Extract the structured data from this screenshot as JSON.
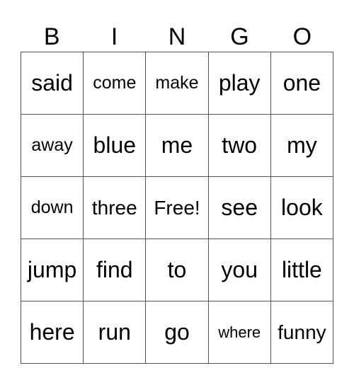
{
  "header": [
    "B",
    "I",
    "N",
    "G",
    "O"
  ],
  "rows": [
    [
      "said",
      "come",
      "make",
      "play",
      "one"
    ],
    [
      "away",
      "blue",
      "me",
      "two",
      "my"
    ],
    [
      "down",
      "three",
      "Free!",
      "see",
      "look"
    ],
    [
      "jump",
      "find",
      "to",
      "you",
      "little"
    ],
    [
      "here",
      "run",
      "go",
      "where",
      "funny"
    ]
  ]
}
